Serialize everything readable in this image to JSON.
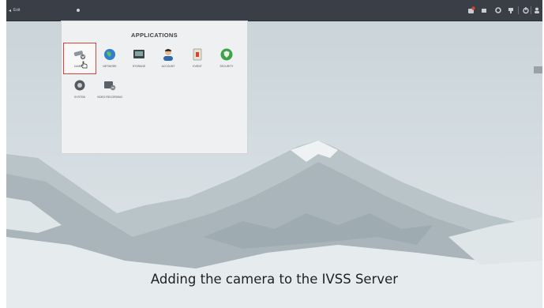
{
  "topbar": {
    "exit_label": "Exit",
    "icons": [
      "alarm-icon",
      "storage-status-icon",
      "settings-icon",
      "network-icon",
      "power-icon",
      "user-icon"
    ]
  },
  "apps_panel": {
    "title": "APPLICATIONS",
    "apps": [
      {
        "label": "CAMERA",
        "icon": "camera-icon"
      },
      {
        "label": "NETWORK",
        "icon": "network-globe-icon"
      },
      {
        "label": "STORAGE",
        "icon": "storage-icon"
      },
      {
        "label": "ACCOUNT",
        "icon": "account-icon"
      },
      {
        "label": "EVENT",
        "icon": "event-icon"
      },
      {
        "label": "SECURITY",
        "icon": "security-shield-icon"
      },
      {
        "label": "SYSTEM",
        "icon": "system-icon"
      },
      {
        "label": "VIDEO RECORDING",
        "icon": "video-recording-icon"
      }
    ],
    "selected": "CAMERA"
  },
  "caption": "Adding the camera to the IVSS Server",
  "colors": {
    "topbar": "#3a3e46",
    "highlight": "#e0403a",
    "panel": "#eef0f1"
  }
}
